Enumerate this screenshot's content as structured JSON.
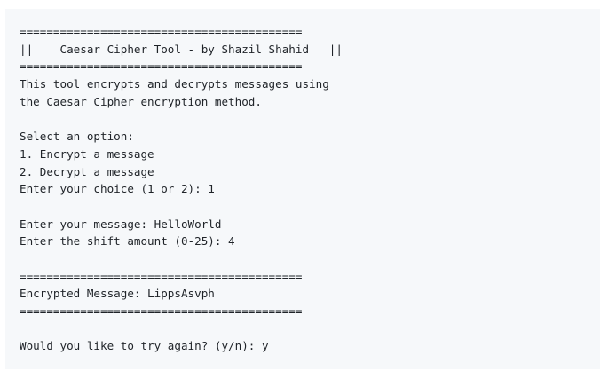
{
  "terminal": {
    "lines": [
      "==========================================",
      "||    Caesar Cipher Tool - by Shazil Shahid   ||",
      "==========================================",
      "This tool encrypts and decrypts messages using",
      "the Caesar Cipher encryption method.",
      "",
      "Select an option:",
      "1. Encrypt a message",
      "2. Decrypt a message",
      "Enter your choice (1 or 2): 1",
      "",
      "Enter your message: HelloWorld",
      "Enter the shift amount (0-25): 4",
      "",
      "==========================================",
      "Encrypted Message: LippsAsvph",
      "==========================================",
      "",
      "Would you like to try again? (y/n): y"
    ]
  }
}
